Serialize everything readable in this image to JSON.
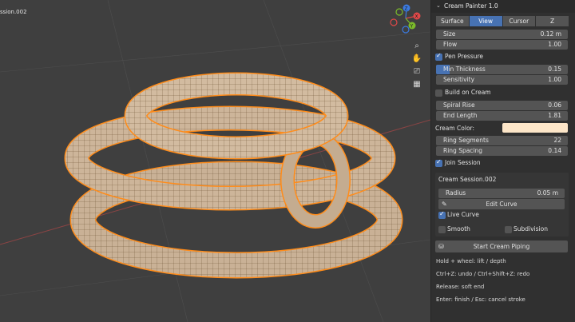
{
  "viewport": {
    "object_name": "ssion.002",
    "nav_icons": [
      "zoom-icon",
      "hand-icon",
      "camera-icon",
      "grid-icon"
    ],
    "accent_color": "#ff8c1a",
    "axes": [
      "X",
      "Y",
      "Z"
    ]
  },
  "panel": {
    "title": "Cream Painter 1.0",
    "tabs": [
      {
        "label": "Surface"
      },
      {
        "label": "View",
        "active": true
      },
      {
        "label": "Cursor"
      },
      {
        "label": "Z"
      }
    ],
    "size": {
      "label": "Size",
      "value": "0.12 m"
    },
    "flow": {
      "label": "Flow",
      "value": "1.00"
    },
    "pen_pressure": {
      "label": "Pen Pressure",
      "checked": true
    },
    "min_thickness": {
      "label": "Min Thickness",
      "value": "0.15"
    },
    "sensitivity": {
      "label": "Sensitivity",
      "value": "1.00"
    },
    "build_on_cream": {
      "label": "Build on Cream",
      "checked": false
    },
    "spiral_rise": {
      "label": "Spiral Rise",
      "value": "0.06"
    },
    "end_length": {
      "label": "End Length",
      "value": "1.81"
    },
    "cream_color": {
      "label": "Cream Color:",
      "swatch": "#fde6c8"
    },
    "ring_segments": {
      "label": "Ring Segments",
      "value": "22"
    },
    "ring_spacing": {
      "label": "Ring Spacing",
      "value": "0.14"
    },
    "join_session": {
      "label": "Join Session",
      "checked": true
    },
    "session": {
      "name": "Cream Session.002",
      "radius": {
        "label": "Radius",
        "value": "0.05 m"
      },
      "edit_curve": "Edit Curve",
      "live_curve": {
        "label": "Live Curve",
        "checked": true
      },
      "smooth": {
        "label": "Smooth",
        "checked": false
      },
      "subdivision": {
        "label": "Subdivision",
        "checked": false
      }
    },
    "start_button": "Start Cream Piping",
    "help": [
      "Hold + wheel: lift / depth",
      "Ctrl+Z: undo / Ctrl+Shift+Z: redo",
      "Release: soft end",
      "Enter: finish / Esc: cancel stroke"
    ]
  }
}
